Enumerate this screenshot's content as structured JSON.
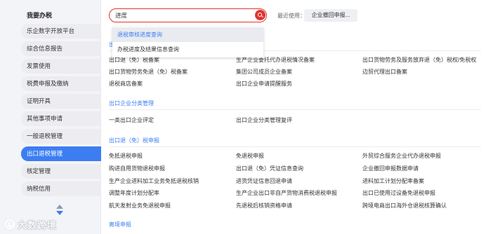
{
  "sidebar": {
    "title": "我要办税",
    "items": [
      {
        "label": "乐企数字开放平台",
        "active": false
      },
      {
        "label": "综合信息报告",
        "active": false
      },
      {
        "label": "发票使用",
        "active": false
      },
      {
        "label": "税费申报及缴纳",
        "active": false
      },
      {
        "label": "证明开具",
        "active": false
      },
      {
        "label": "其他事项申请",
        "active": false
      },
      {
        "label": "一般退税管理",
        "active": false
      },
      {
        "label": "出口退税管理",
        "active": true
      },
      {
        "label": "核定管理",
        "active": false
      },
      {
        "label": "纳税信用",
        "active": false
      }
    ]
  },
  "search": {
    "value": "进度",
    "recent_label": "最近使用：",
    "recent_chip": "企业撤回申报..."
  },
  "dropdown": {
    "items": [
      "退税审核进度查询",
      "办税进度及结果信息查询"
    ]
  },
  "sections": {
    "filing": {
      "title": "出",
      "rows": [
        [
          "出口退（免）税备案",
          "生产企业委托代办退税情况备案",
          "出口货物劳务及服务放弃退（免）税权/免税权"
        ],
        [
          "出口货物劳务免退（免）税备案",
          "集团公司成员企业备案",
          "边贸代理出口备案"
        ],
        [
          "退税商店备案",
          "出口企业申请提醒服务",
          ""
        ]
      ]
    },
    "classification": {
      "title": "出口企业分类管理",
      "rows": [
        [
          "一类出口企业评定",
          "出口企业分类管理复评",
          ""
        ]
      ]
    },
    "declaration": {
      "title": "出口退（免）税申报",
      "rows": [
        [
          "免抵退税申报",
          "免退税申报",
          "外贸综合服务企业代办退税申报"
        ],
        [
          "购进自用货物退税申报",
          "出口退（免）凭证信息查询",
          "企业撤回申报数据申请"
        ],
        [
          "生产企业进料加工业务免抵退税核销",
          "进货凭证信息回退申请",
          "进料加工计划分配率备案"
        ],
        [
          "调整年度计划分配率",
          "生产企业出口非自产货物消费税退税申报",
          "出口已使用过设备免退税申报"
        ],
        [
          "航天发射业务免退税申报",
          "先退税后核销资格申请",
          "跨境电商出口海外仓退税核算确认"
        ]
      ]
    },
    "offshore": {
      "title": "离境申报"
    }
  },
  "watermark": {
    "text": "大数跨境"
  },
  "colors": {
    "accent": "#3c7ef2",
    "search_border": "#e0342f",
    "sidebar_bg": "#f3f4f7"
  }
}
